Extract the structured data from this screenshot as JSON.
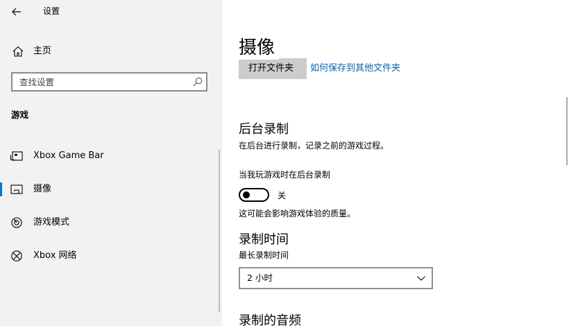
{
  "window": {
    "title": "设置",
    "controls": {
      "minimize_icon": "minimize-icon",
      "maximize_icon": "maximize-icon",
      "close_icon": "close-icon"
    }
  },
  "sidebar": {
    "home_label": "主页",
    "search_placeholder": "查找设置",
    "section_heading": "游戏",
    "items": [
      {
        "label": "Xbox Game Bar",
        "icon": "gamebar-icon",
        "selected": false
      },
      {
        "label": "摄像",
        "icon": "capture-icon",
        "selected": true
      },
      {
        "label": "游戏模式",
        "icon": "gauge-icon",
        "selected": false
      },
      {
        "label": "Xbox 网络",
        "icon": "xbox-icon",
        "selected": false
      }
    ]
  },
  "main": {
    "page_title": "摄像",
    "open_folder_label": "打开文件夹",
    "help_link": "如何保存到其他文件夹",
    "background_recording": {
      "heading": "后台录制",
      "description": "在后台进行录制，记录之前的游戏过程。",
      "toggle_label": "当我玩游戏时在后台录制",
      "toggle_state": "关",
      "toggle_on": false,
      "note": "这可能会影响游戏体验的质量。"
    },
    "recording_length": {
      "heading": "录制时间",
      "label": "最长录制时间",
      "selected_value": "2 小时"
    },
    "recorded_audio": {
      "heading": "录制的音频"
    }
  },
  "colors": {
    "sidebar_bg": "#f2f2f2",
    "accent": "#0078d7",
    "link": "#0066b4",
    "button_bg": "#cccccc"
  }
}
